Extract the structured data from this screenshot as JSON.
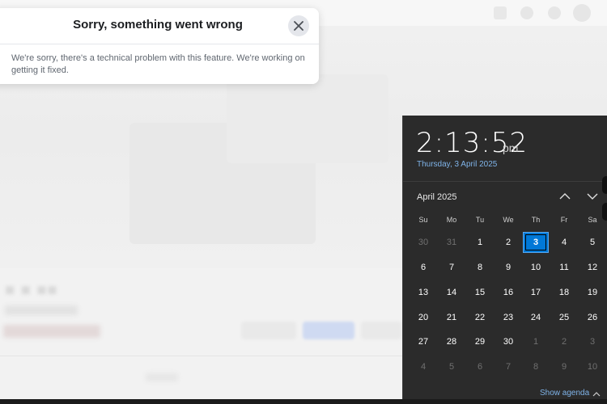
{
  "dialog": {
    "title": "Sorry, something went wrong",
    "close_icon": "close-icon",
    "message": "We're sorry, there's a technical problem with this feature. We're working on getting it fixed."
  },
  "clock": {
    "time": "2:13:52",
    "ampm": "pm",
    "date": "Thursday, 3 April 2025"
  },
  "calendar": {
    "month_label": "April 2025",
    "prev_icon": "chevron-up-icon",
    "next_icon": "chevron-down-icon",
    "weekdays": [
      "Su",
      "Mo",
      "Tu",
      "We",
      "Th",
      "Fr",
      "Sa"
    ],
    "weeks": [
      [
        "30",
        "31",
        "1",
        "2",
        "3",
        "4",
        "5"
      ],
      [
        "6",
        "7",
        "8",
        "9",
        "10",
        "11",
        "12"
      ],
      [
        "13",
        "14",
        "15",
        "16",
        "17",
        "18",
        "19"
      ],
      [
        "20",
        "21",
        "22",
        "23",
        "24",
        "25",
        "26"
      ],
      [
        "27",
        "28",
        "29",
        "30",
        "1",
        "2",
        "3"
      ],
      [
        "4",
        "5",
        "6",
        "7",
        "8",
        "9",
        "10"
      ]
    ],
    "other_month_cells": [
      "0-0",
      "0-1",
      "4-4",
      "4-5",
      "4-6",
      "5-0",
      "5-1",
      "5-2",
      "5-3",
      "5-4",
      "5-5",
      "5-6"
    ],
    "today_cell": "0-4",
    "accent_color": "#0078d7"
  },
  "agenda": {
    "label": "Show agenda",
    "icon": "chevron-up-icon"
  }
}
